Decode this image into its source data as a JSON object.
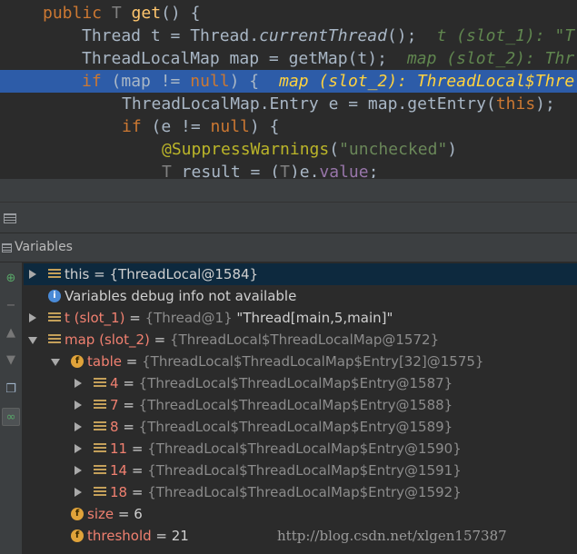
{
  "editor": {
    "line1": {
      "kw": "public",
      "type": " T ",
      "fn": "get",
      "rest": "() {"
    },
    "line2": {
      "code_a": "Thread t = Thread.",
      "call": "currentThread",
      "code_b": "();",
      "hint": "t (slot_1): \"T"
    },
    "line3": {
      "code": "ThreadLocalMap map = getMap(t);",
      "hint": "map (slot_2): Thr"
    },
    "line4": {
      "kw1": "if",
      "code_a": " (map != ",
      "kw2": "null",
      "code_b": ") {",
      "hint": "map (slot_2): ThreadLocal$Thre"
    },
    "line5": {
      "code_a": "ThreadLocalMap.Entry e = map.getEntry(",
      "kw": "this",
      "code_b": ");"
    },
    "line6": {
      "kw1": "if",
      "code_a": " (e != ",
      "kw2": "null",
      "code_b": ") {"
    },
    "line7": {
      "ann": "@SuppressWarnings",
      "p1": "(",
      "str": "\"unchecked\"",
      "p2": ")"
    },
    "line8": {
      "type1": "T",
      "code_a": " result = (",
      "type2": "T",
      "code_b": ")e.",
      "field": "value",
      "end": ";"
    }
  },
  "panel": {
    "title": "Variables"
  },
  "side_icons": [
    "step-icon",
    "minus-icon",
    "up-icon",
    "down-icon",
    "copy-icon",
    "watch-icon"
  ],
  "variables": [
    {
      "name": "this",
      "eq": " = ",
      "value": "{ThreadLocal@1584}"
    },
    {
      "info": "Variables debug info not available"
    },
    {
      "name": "t (slot_1)",
      "eq": " = ",
      "value": "{Thread@1}",
      "value_str": " \"Thread[main,5,main]\""
    },
    {
      "name": "map (slot_2)",
      "eq": " = ",
      "value": "{ThreadLocal$ThreadLocalMap@1572}"
    },
    {
      "name": "table",
      "eq": " = ",
      "value": "{ThreadLocal$ThreadLocalMap$Entry[32]@1575}"
    },
    {
      "name": "4",
      "eq": " = ",
      "value": "{ThreadLocal$ThreadLocalMap$Entry@1587}"
    },
    {
      "name": "7",
      "eq": " = ",
      "value": "{ThreadLocal$ThreadLocalMap$Entry@1588}"
    },
    {
      "name": "8",
      "eq": " = ",
      "value": "{ThreadLocal$ThreadLocalMap$Entry@1589}"
    },
    {
      "name": "11",
      "eq": " = ",
      "value": "{ThreadLocal$ThreadLocalMap$Entry@1590}"
    },
    {
      "name": "14",
      "eq": " = ",
      "value": "{ThreadLocal$ThreadLocalMap$Entry@1591}"
    },
    {
      "name": "18",
      "eq": " = ",
      "value": "{ThreadLocal$ThreadLocalMap$Entry@1592}"
    },
    {
      "name": "size",
      "eq": " = ",
      "value": "6"
    },
    {
      "name": "threshold",
      "eq": " = ",
      "value": "21"
    }
  ],
  "watermark": "http://blog.csdn.net/xlgen157387"
}
